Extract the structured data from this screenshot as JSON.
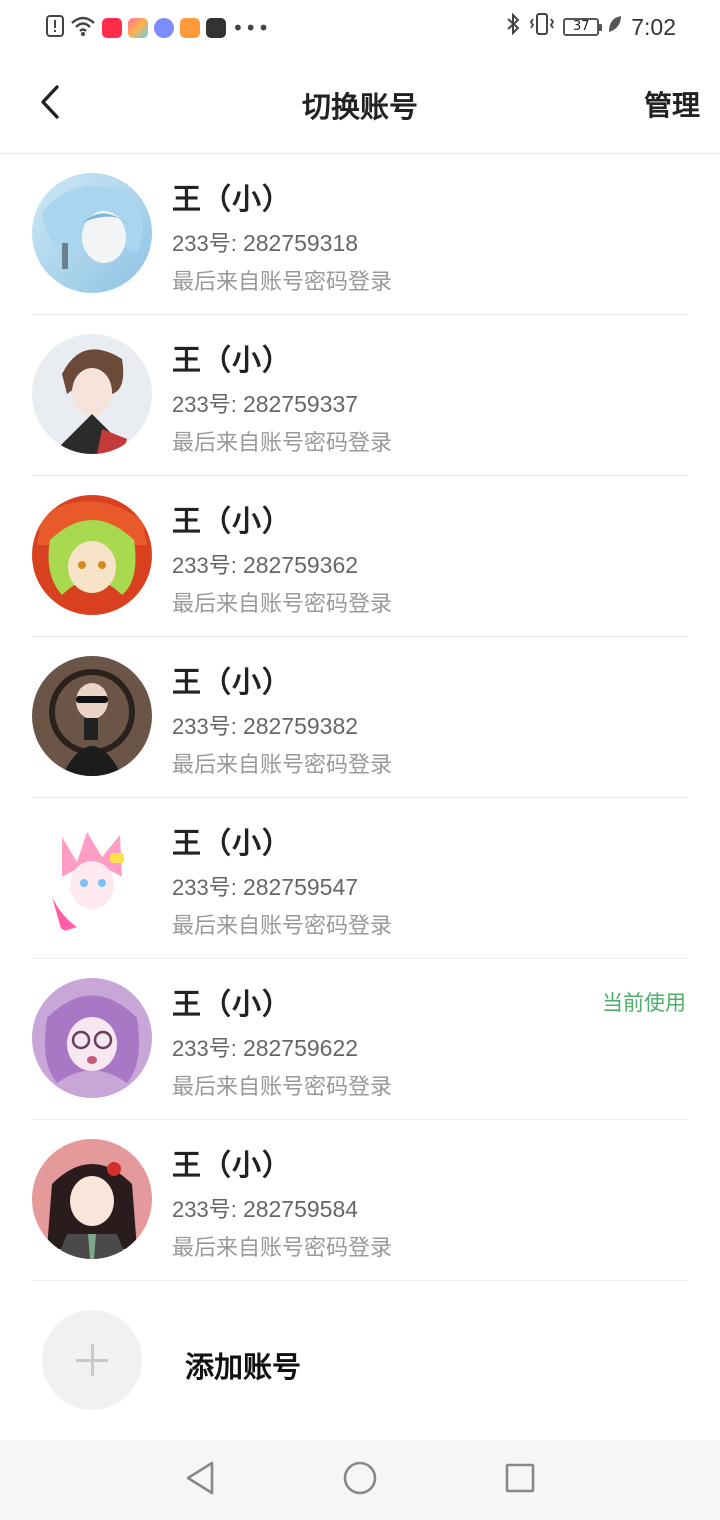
{
  "status_bar": {
    "time": "7:02",
    "battery": "37",
    "left_icons": [
      "alert-icon",
      "wifi-icon",
      "xiaohongshu-icon",
      "shopping-icon",
      "music-icon",
      "video-icon",
      "capcut-icon",
      "more-dots-icon"
    ],
    "right_icons": [
      "bluetooth-icon",
      "vibrate-icon",
      "battery-icon",
      "leaf-icon"
    ]
  },
  "header": {
    "title": "切换账号",
    "manage_label": "管理",
    "back_icon": "chevron-left-icon"
  },
  "accounts": [
    {
      "name": "王（小）",
      "id_prefix": "233号: ",
      "id": "282759318",
      "login": "最后来自账号密码登录",
      "current": ""
    },
    {
      "name": "王（小）",
      "id_prefix": "233号: ",
      "id": "282759337",
      "login": "最后来自账号密码登录",
      "current": ""
    },
    {
      "name": "王（小）",
      "id_prefix": "233号: ",
      "id": "282759362",
      "login": "最后来自账号密码登录",
      "current": ""
    },
    {
      "name": "王（小）",
      "id_prefix": "233号: ",
      "id": "282759382",
      "login": "最后来自账号密码登录",
      "current": ""
    },
    {
      "name": "王（小）",
      "id_prefix": "233号: ",
      "id": "282759547",
      "login": "最后来自账号密码登录",
      "current": ""
    },
    {
      "name": "王（小）",
      "id_prefix": "233号: ",
      "id": "282759622",
      "login": "最后来自账号密码登录",
      "current": "当前使用"
    },
    {
      "name": "王（小）",
      "id_prefix": "233号: ",
      "id": "282759584",
      "login": "最后来自账号密码登录",
      "current": ""
    }
  ],
  "add_account": {
    "label": "添加账号",
    "icon": "plus-icon"
  },
  "nav": {
    "icons": [
      "back-triangle-icon",
      "home-circle-icon",
      "recents-square-icon"
    ]
  },
  "colors": {
    "accent_green": "#4caf6a",
    "divider": "#ececec",
    "muted_text": "#999999"
  }
}
